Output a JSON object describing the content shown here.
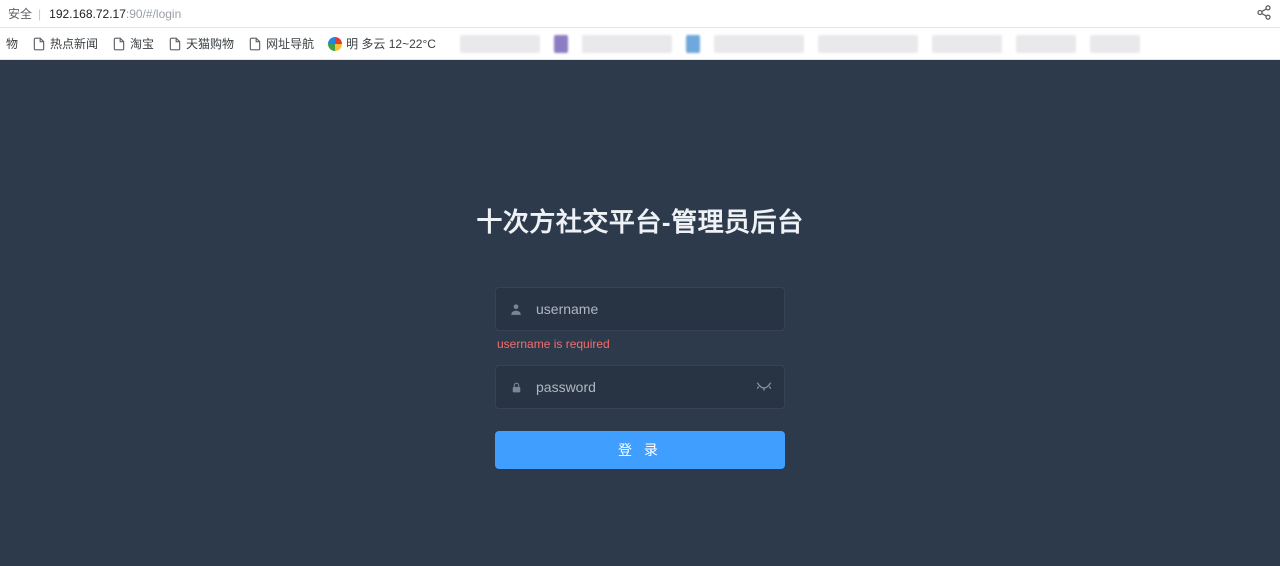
{
  "browser": {
    "security_label": "安全",
    "url_host": "192.168.72.17",
    "url_rest": ":90/#/login"
  },
  "bookmarks": {
    "first_truncated": "物",
    "items": [
      "热点新闻",
      "淘宝",
      "天猫购物",
      "网址导航"
    ],
    "weather": "明 多云 12~22°C"
  },
  "login": {
    "title": "十次方社交平台-管理员后台",
    "username_placeholder": "username",
    "username_error": "username is required",
    "password_placeholder": "password",
    "submit_label": "登 录"
  }
}
